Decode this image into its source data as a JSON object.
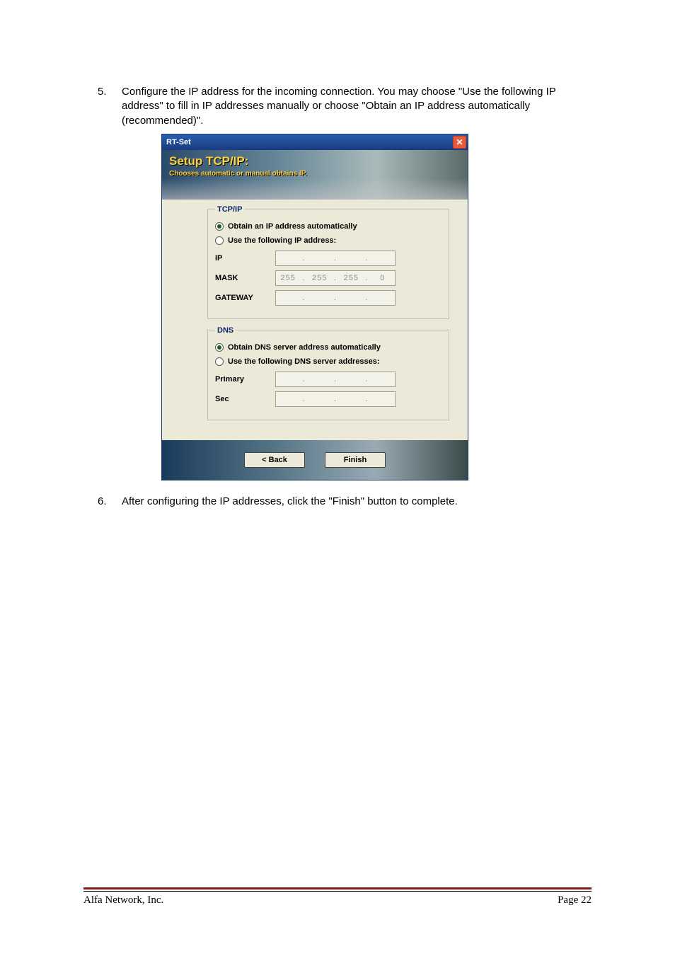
{
  "steps": {
    "five": {
      "num": "5.",
      "text": "Configure the IP address for the incoming connection. You may choose \"Use the following IP address\" to fill in IP addresses manually or choose \"Obtain an IP address automatically (recommended)\"."
    },
    "six": {
      "num": "6.",
      "text": "After configuring the IP addresses, click the \"Finish\" button to complete."
    }
  },
  "dialog": {
    "title": "RT-Set",
    "close_glyph": "✕",
    "header_title": "Setup TCP/IP:",
    "header_sub": "Chooses automatic or manual obtains IP.",
    "tcpip": {
      "legend": "TCP/IP",
      "obtain": "Obtain an IP address automatically",
      "usefollowing": "Use the following IP address:",
      "ip_label": "IP",
      "mask_label": "MASK",
      "gateway_label": "GATEWAY",
      "ip": [
        "",
        "",
        "",
        ""
      ],
      "mask": [
        "255",
        "255",
        "255",
        "0"
      ],
      "gateway": [
        "",
        "",
        "",
        ""
      ],
      "dot": "."
    },
    "dns": {
      "legend": "DNS",
      "obtain": "Obtain DNS server address automatically",
      "usefollowing": "Use the following DNS server addresses:",
      "primary_label": "Primary",
      "sec_label": "Sec",
      "primary": [
        "",
        "",
        "",
        ""
      ],
      "sec": [
        "",
        "",
        "",
        ""
      ],
      "dot": "."
    },
    "buttons": {
      "back": "< Back",
      "finish": "Finish"
    }
  },
  "footer": {
    "left": "Alfa Network, Inc.",
    "right": "Page 22"
  }
}
